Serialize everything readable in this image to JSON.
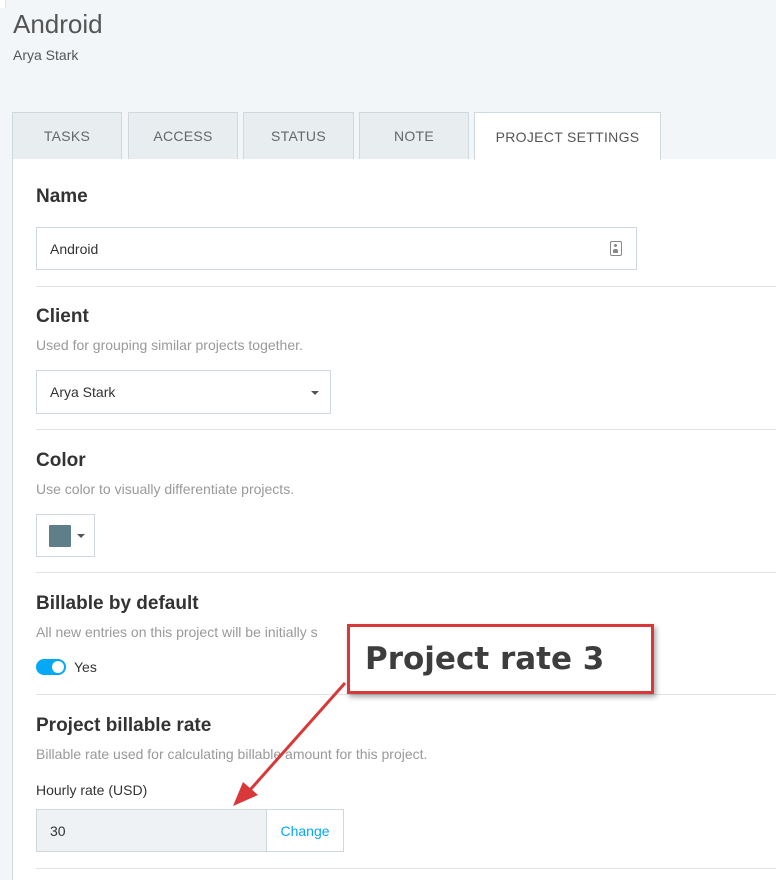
{
  "project": {
    "title": "Android",
    "client": "Arya Stark"
  },
  "tabs": [
    {
      "label": "TASKS"
    },
    {
      "label": "ACCESS"
    },
    {
      "label": "STATUS"
    },
    {
      "label": "NOTE"
    },
    {
      "label": "PROJECT SETTINGS",
      "active": true
    }
  ],
  "settings": {
    "name": {
      "title": "Name",
      "value": "Android"
    },
    "client": {
      "title": "Client",
      "description": "Used for grouping similar projects together.",
      "selected": "Arya Stark"
    },
    "color": {
      "title": "Color",
      "description": "Use color to visually differentiate projects.",
      "value": "#5f7f88"
    },
    "billable": {
      "title": "Billable by default",
      "description": "All new entries on this project will be initially s",
      "toggle_label": "Yes",
      "enabled": true
    },
    "rate": {
      "title": "Project billable rate",
      "description": "Billable rate used for calculating billable amount for this project.",
      "field_label": "Hourly rate (USD)",
      "value": "30",
      "change_label": "Change"
    }
  },
  "annotation": {
    "text": "Project rate 3",
    "color": "#d9383a"
  }
}
